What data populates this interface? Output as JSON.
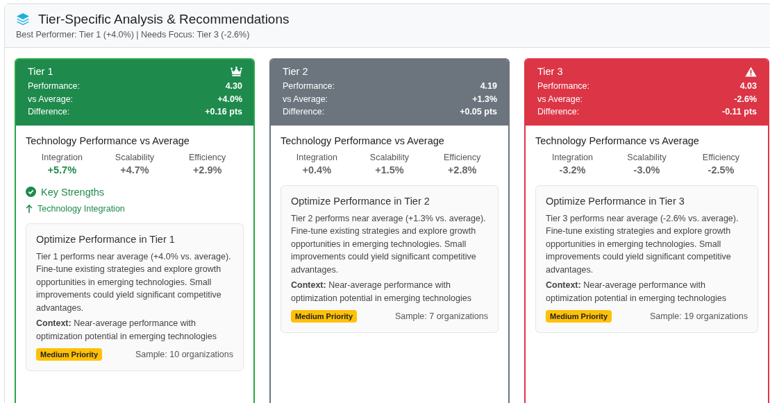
{
  "panel": {
    "title": "Tier-Specific Analysis & Recommendations",
    "subtitle": "Best Performer: Tier 1 (+4.0%) | Needs Focus: Tier 3 (-2.6%)"
  },
  "tiers": [
    {
      "kind": "top",
      "name": "Tier 1",
      "stats": [
        {
          "label": "Performance:",
          "value": "4.30"
        },
        {
          "label": "vs Average:",
          "value": "+4.0%"
        },
        {
          "label": "Difference:",
          "value": "+0.16 pts"
        }
      ],
      "section_title": "Technology Performance vs Average",
      "metrics": [
        {
          "label": "Integration",
          "value": "+5.7%",
          "highlighted": true
        },
        {
          "label": "Scalability",
          "value": "+4.7%",
          "highlighted": false
        },
        {
          "label": "Efficiency",
          "value": "+2.9%",
          "highlighted": false
        }
      ],
      "strengths": {
        "title": "Key Strengths",
        "items": [
          "Technology Integration"
        ]
      },
      "recommendation": {
        "title": "Optimize Performance in Tier 1",
        "text": "Tier 1 performs near average (+4.0% vs. average). Fine-tune existing strategies and explore growth opportunities in emerging technologies. Small improvements could yield significant competitive advantages.",
        "context": "**Context:** Near-average performance with optimization potential in emerging technologies",
        "priority": "Medium Priority",
        "sample": "Sample: 10 organizations"
      }
    },
    {
      "kind": "neutral",
      "name": "Tier 2",
      "stats": [
        {
          "label": "Performance:",
          "value": "4.19"
        },
        {
          "label": "vs Average:",
          "value": "+1.3%"
        },
        {
          "label": "Difference:",
          "value": "+0.05 pts"
        }
      ],
      "section_title": "Technology Performance vs Average",
      "metrics": [
        {
          "label": "Integration",
          "value": "+0.4%",
          "highlighted": false
        },
        {
          "label": "Scalability",
          "value": "+1.5%",
          "highlighted": false
        },
        {
          "label": "Efficiency",
          "value": "+2.8%",
          "highlighted": false
        }
      ],
      "recommendation": {
        "title": "Optimize Performance in Tier 2",
        "text": "Tier 2 performs near average (+1.3% vs. average). Fine-tune existing strategies and explore growth opportunities in emerging technologies. Small improvements could yield significant competitive advantages.",
        "context": "**Context:** Near-average performance with optimization potential in emerging technologies",
        "priority": "Medium Priority",
        "sample": "Sample: 7 organizations"
      }
    },
    {
      "kind": "low",
      "name": "Tier 3",
      "stats": [
        {
          "label": "Performance:",
          "value": "4.03"
        },
        {
          "label": "vs Average:",
          "value": "-2.6%"
        },
        {
          "label": "Difference:",
          "value": "-0.11 pts"
        }
      ],
      "section_title": "Technology Performance vs Average",
      "metrics": [
        {
          "label": "Integration",
          "value": "-3.2%",
          "highlighted": false
        },
        {
          "label": "Scalability",
          "value": "-3.0%",
          "highlighted": false
        },
        {
          "label": "Efficiency",
          "value": "-2.5%",
          "highlighted": false
        }
      ],
      "recommendation": {
        "title": "Optimize Performance in Tier 3",
        "text": "Tier 3 performs near average (-2.6% vs. average). Fine-tune existing strategies and explore growth opportunities in emerging technologies. Small improvements could yield significant competitive advantages.",
        "context": "**Context:** Near-average performance with optimization potential in emerging technologies",
        "priority": "Medium Priority",
        "sample": "Sample: 19 organizations"
      }
    }
  ]
}
